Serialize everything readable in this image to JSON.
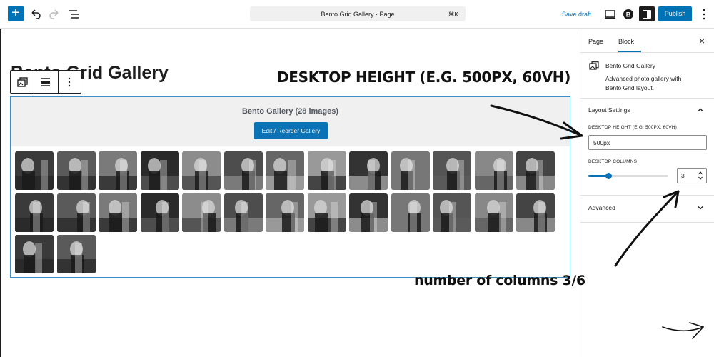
{
  "topbar": {
    "add_symbol": "+",
    "command_bar_title": "Bento Grid Gallery · Page",
    "command_bar_shortcut": "⌘K",
    "save_draft_label": "Save draft",
    "publish_label": "Publish",
    "icons": [
      "plus-icon",
      "undo-icon",
      "redo-icon",
      "document-overview-icon",
      "desktop-preview-icon",
      "plugin-b-icon",
      "settings-icon",
      "more-vertical-icon"
    ]
  },
  "canvas": {
    "page_title": "Bento Grid Gallery",
    "block_toolbar_icons": [
      "gallery-block-icon",
      "align-icon",
      "more-vertical-icon"
    ],
    "gallery": {
      "count_label": "Bento Gallery (28 images)",
      "edit_button_label": "Edit / Reorder Gallery",
      "image_count": 28
    }
  },
  "sidebar": {
    "tabs": [
      {
        "label": "Page",
        "active": false
      },
      {
        "label": "Block",
        "active": true
      }
    ],
    "close_symbol": "×",
    "block_card": {
      "name": "Bento Grid Gallery",
      "description": "Advanced photo gallery with Bento Grid layout."
    },
    "layout_settings": {
      "title": "Layout Settings",
      "height_label": "DESKTOP HEIGHT (E.G. 500PX, 60VH)",
      "height_value": "500px",
      "columns_label": "DESKTOP COLUMNS",
      "columns_value": "3",
      "slider_fraction": 0.26
    },
    "advanced": {
      "title": "Advanced"
    }
  },
  "annotations": {
    "height_note": "DESKTOP HEIGHT (E.G. 500PX, 60VH)",
    "columns_note": "number of columns 3/6"
  },
  "colors": {
    "accent": "#0073b6",
    "selection_border": "#3b8fc4",
    "header_bg": "#f0f0f0"
  }
}
